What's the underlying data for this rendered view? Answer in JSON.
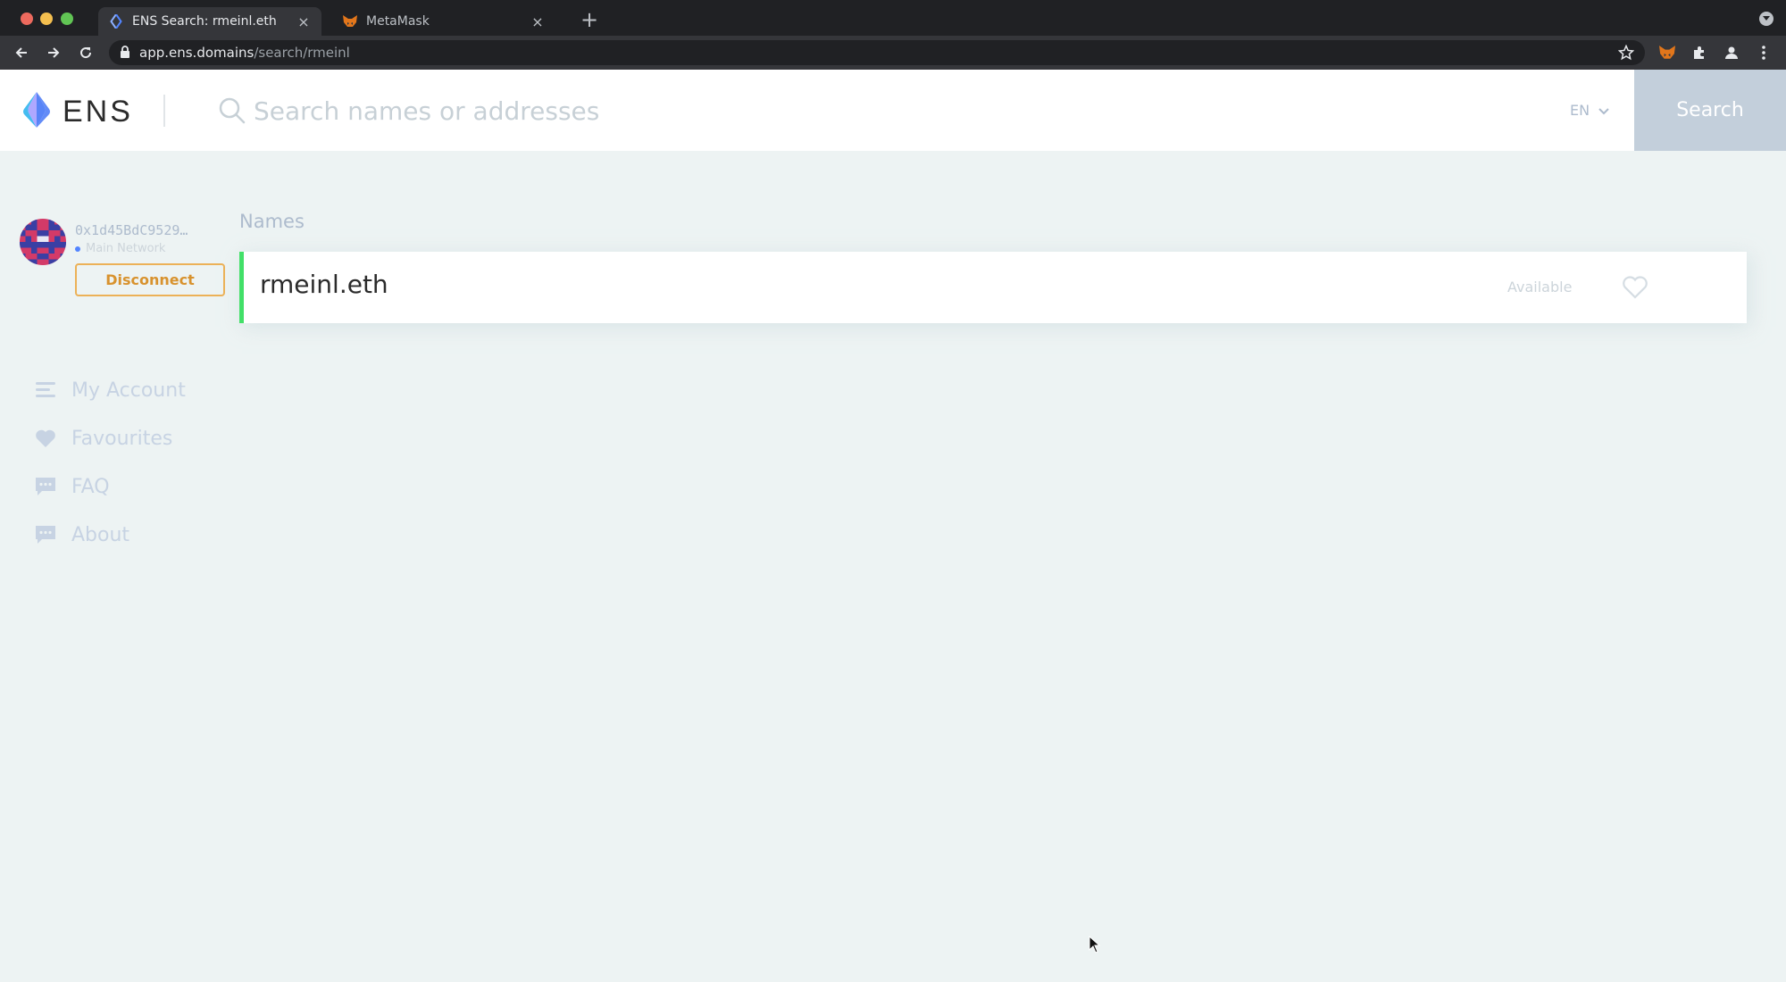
{
  "browser": {
    "tabs": [
      {
        "title": "ENS Search: rmeinl.eth",
        "active": true,
        "favicon": "ens-icon"
      },
      {
        "title": "MetaMask",
        "active": false,
        "favicon": "metamask-fox-icon"
      }
    ],
    "new_tab": "+",
    "close_glyph": "×",
    "url_host": "app.ens.domains",
    "url_path": "/search/rmeinl"
  },
  "header": {
    "logo_text": "ENS",
    "search_placeholder": "Search names or addresses",
    "search_value": "",
    "language": "EN",
    "search_button": "Search"
  },
  "account": {
    "address": "0x1d45BdC9529…",
    "network": "Main Network",
    "disconnect_label": "Disconnect"
  },
  "sidebar": {
    "items": [
      {
        "label": "My Account",
        "icon": "account-list-icon"
      },
      {
        "label": "Favourites",
        "icon": "heart-icon"
      },
      {
        "label": "FAQ",
        "icon": "chat-bubble-icon"
      },
      {
        "label": "About",
        "icon": "chat-bubble-icon"
      }
    ]
  },
  "main": {
    "heading": "Names",
    "results": [
      {
        "name": "rmeinl.eth",
        "status": "Available",
        "favourited": false
      }
    ]
  },
  "colors": {
    "available_accent": "#42e068",
    "disconnect_accent": "#ecb157",
    "search_button_bg": "#c3cfdb",
    "page_bg": "#edf3f3"
  }
}
